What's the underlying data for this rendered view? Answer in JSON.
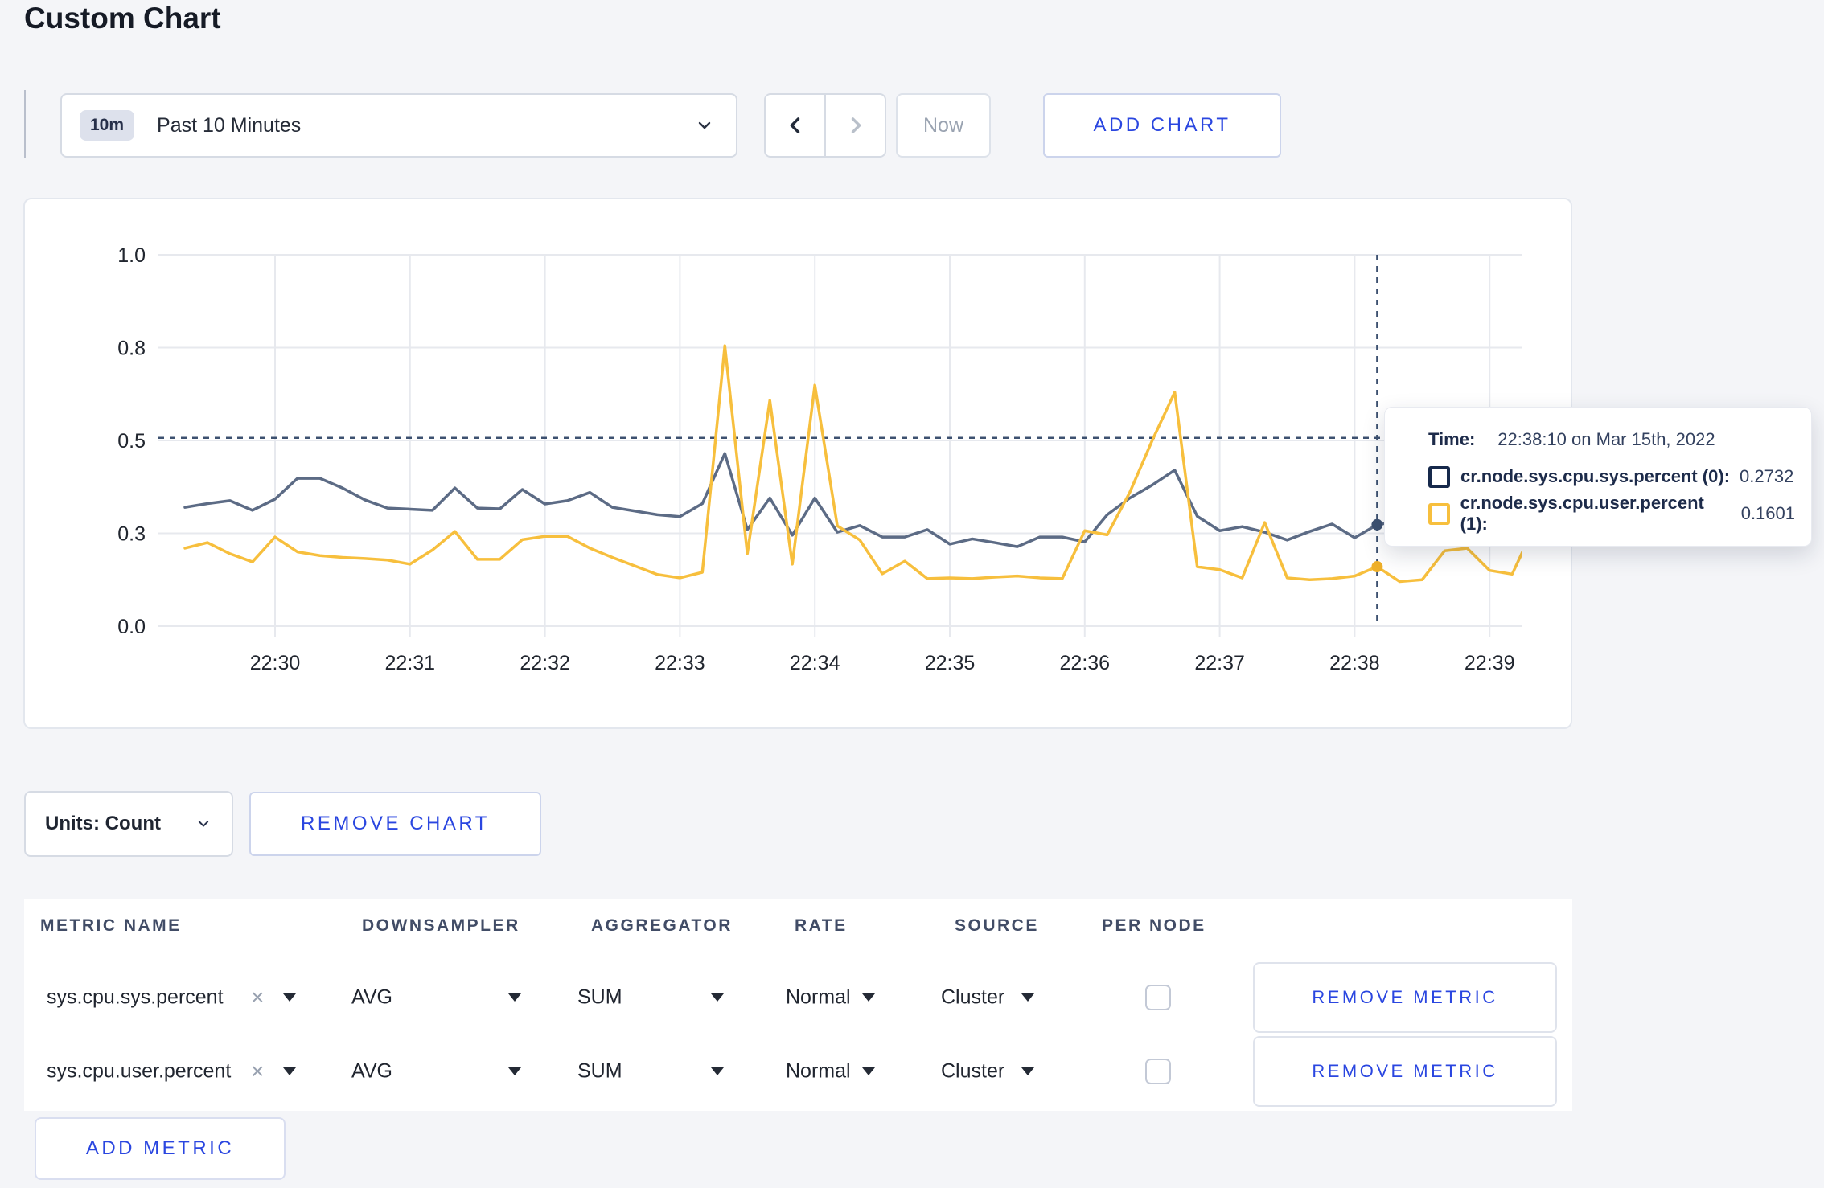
{
  "page": {
    "title": "Custom Chart"
  },
  "toolbar": {
    "range_badge": "10m",
    "range_label": "Past 10 Minutes",
    "now_label": "Now",
    "add_chart_label": "ADD CHART"
  },
  "icons": {
    "close": "×"
  },
  "colors": {
    "accent_blue": "#2a46e0",
    "grid": "#e7e9ee",
    "crosshair": "#3d5170",
    "page_bg": "#f4f5f8",
    "axis_text": "#21262f"
  },
  "chart_data": {
    "type": "line",
    "title": "",
    "xlabel": "",
    "ylabel": "",
    "ylim": [
      0,
      1
    ],
    "grid": true,
    "legend": "none",
    "x_interval_seconds": 10,
    "x_start": "22:29:20",
    "x_ticks": [
      "22:30",
      "22:31",
      "22:32",
      "22:33",
      "22:34",
      "22:35",
      "22:36",
      "22:37",
      "22:38",
      "22:39"
    ],
    "y_ticks": [
      {
        "label": "0.0",
        "value": 0
      },
      {
        "label": "0.3",
        "value": 0.25
      },
      {
        "label": "0.5",
        "value": 0.5
      },
      {
        "label": "0.8",
        "value": 0.75
      },
      {
        "label": "1.0",
        "value": 1
      }
    ],
    "times": [
      "22:29:20",
      "22:29:30",
      "22:29:40",
      "22:29:50",
      "22:30:00",
      "22:30:10",
      "22:30:20",
      "22:30:30",
      "22:30:40",
      "22:30:50",
      "22:31:00",
      "22:31:10",
      "22:31:20",
      "22:31:30",
      "22:31:40",
      "22:31:50",
      "22:32:00",
      "22:32:10",
      "22:32:20",
      "22:32:30",
      "22:32:40",
      "22:32:50",
      "22:33:00",
      "22:33:10",
      "22:33:20",
      "22:33:30",
      "22:33:40",
      "22:33:50",
      "22:34:00",
      "22:34:10",
      "22:34:20",
      "22:34:30",
      "22:34:40",
      "22:34:50",
      "22:35:00",
      "22:35:10",
      "22:35:20",
      "22:35:30",
      "22:35:40",
      "22:35:50",
      "22:36:00",
      "22:36:10",
      "22:36:20",
      "22:36:30",
      "22:36:40",
      "22:36:50",
      "22:37:00",
      "22:37:10",
      "22:37:20",
      "22:37:30",
      "22:37:40",
      "22:37:50",
      "22:38:00",
      "22:38:10",
      "22:38:20",
      "22:38:30",
      "22:38:40",
      "22:38:50",
      "22:39:00",
      "22:39:10",
      "22:39:20"
    ],
    "series": [
      {
        "name": "cr.node.sys.cpu.sys.percent (0)",
        "color": "#5c6b85",
        "dot_color": "#3d5170",
        "values": [
          0.32,
          0.33,
          0.338,
          0.312,
          0.342,
          0.398,
          0.398,
          0.372,
          0.34,
          0.318,
          0.315,
          0.312,
          0.372,
          0.318,
          0.316,
          0.368,
          0.329,
          0.338,
          0.36,
          0.32,
          0.31,
          0.3,
          0.295,
          0.33,
          0.465,
          0.26,
          0.345,
          0.245,
          0.345,
          0.253,
          0.271,
          0.24,
          0.24,
          0.26,
          0.221,
          0.235,
          0.225,
          0.214,
          0.24,
          0.24,
          0.227,
          0.3,
          0.345,
          0.38,
          0.42,
          0.296,
          0.257,
          0.268,
          0.253,
          0.232,
          0.255,
          0.275,
          0.238,
          0.2732,
          0.283,
          0.268,
          0.295,
          0.305,
          0.298,
          0.303,
          0.31
        ]
      },
      {
        "name": "cr.node.sys.cpu.user.percent (1)",
        "color": "#f7bf3d",
        "dot_color": "#efb02a",
        "values": [
          0.21,
          0.225,
          0.195,
          0.173,
          0.24,
          0.2,
          0.19,
          0.185,
          0.182,
          0.178,
          0.167,
          0.205,
          0.255,
          0.18,
          0.18,
          0.233,
          0.242,
          0.242,
          0.21,
          0.185,
          0.162,
          0.139,
          0.13,
          0.145,
          0.755,
          0.195,
          0.608,
          0.167,
          0.649,
          0.27,
          0.232,
          0.141,
          0.175,
          0.128,
          0.13,
          0.128,
          0.132,
          0.135,
          0.13,
          0.128,
          0.257,
          0.246,
          0.36,
          0.5,
          0.63,
          0.16,
          0.152,
          0.13,
          0.279,
          0.13,
          0.125,
          0.128,
          0.135,
          0.1601,
          0.12,
          0.125,
          0.203,
          0.21,
          0.15,
          0.14,
          0.27
        ]
      }
    ],
    "crosshair": {
      "time": "22:38:10",
      "point_index": 53,
      "hover_value": 0.507
    }
  },
  "tooltip": {
    "time_label": "Time:",
    "time_value": "22:38:10 on Mar 15th, 2022",
    "rows": [
      {
        "name": "cr.node.sys.cpu.sys.percent (0):",
        "value": "0.2732",
        "color": "#16294b"
      },
      {
        "name": "cr.node.sys.cpu.user.percent (1):",
        "value": "0.1601",
        "color": "#f7bf3d"
      }
    ]
  },
  "chart_controls": {
    "units_label": "Units: Count",
    "remove_chart_label": "REMOVE CHART"
  },
  "metrics_table": {
    "headers": [
      "METRIC NAME",
      "DOWNSAMPLER",
      "AGGREGATOR",
      "RATE",
      "SOURCE",
      "PER NODE"
    ],
    "rows": [
      {
        "metric": "sys.cpu.sys.percent",
        "downsampler": "AVG",
        "aggregator": "SUM",
        "rate": "Normal",
        "source": "Cluster",
        "per_node_checked": false,
        "remove_label": "REMOVE METRIC"
      },
      {
        "metric": "sys.cpu.user.percent",
        "downsampler": "AVG",
        "aggregator": "SUM",
        "rate": "Normal",
        "source": "Cluster",
        "per_node_checked": false,
        "remove_label": "REMOVE METRIC"
      }
    ],
    "add_metric_label": "ADD METRIC"
  }
}
